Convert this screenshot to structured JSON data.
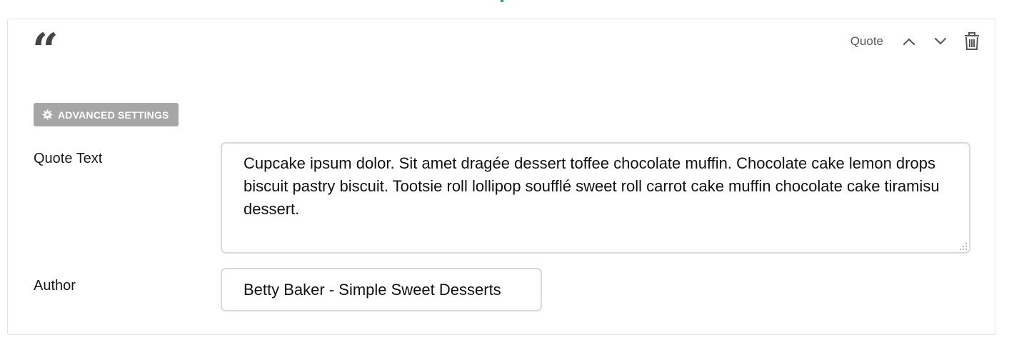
{
  "block": {
    "icon": "quote-icon",
    "quote_glyph": "“",
    "type_label": "Quote",
    "toolbar": {
      "move_up_icon": "chevron-up-icon",
      "move_down_icon": "chevron-down-icon",
      "delete_icon": "trash-icon"
    },
    "advanced_settings": {
      "label": "ADVANCED SETTINGS",
      "icon": "gear-icon"
    },
    "fields": {
      "quote_text": {
        "label": "Quote Text",
        "value": "Cupcake ipsum dolor. Sit amet dragée dessert toffee chocolate muffin. Chocolate cake lemon drops biscuit pastry biscuit. Tootsie roll lollipop soufflé sweet roll carrot cake muffin chocolate cake tiramisu dessert."
      },
      "author": {
        "label": "Author",
        "value": "Betty Baker - Simple Sweet Desserts"
      }
    }
  },
  "colors": {
    "accent": "#2e9e6b",
    "button_bg": "#a6a6a6",
    "border": "#d9d9d9",
    "icon": "#555555"
  }
}
